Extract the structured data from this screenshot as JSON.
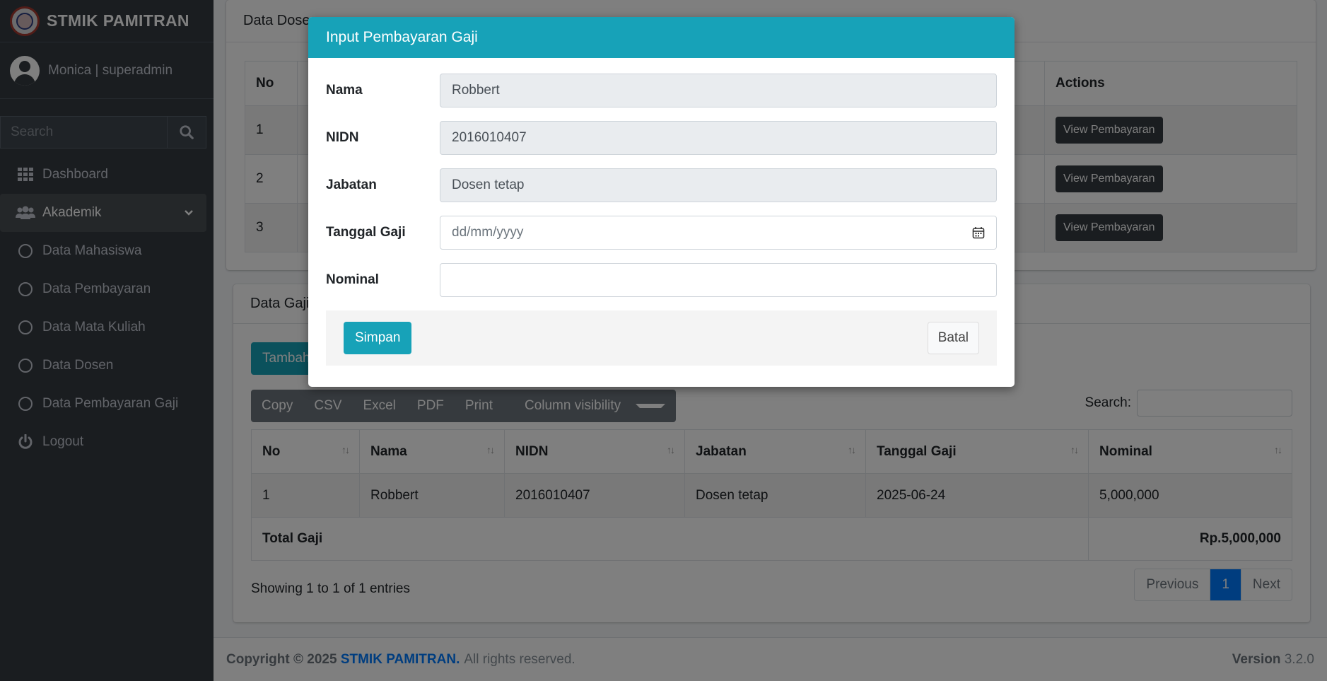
{
  "sidebar": {
    "brand": "STMIK PAMITRAN",
    "user": "Monica | superadmin",
    "search_placeholder": "Search",
    "items": [
      {
        "label": "Dashboard"
      },
      {
        "label": "Akademik"
      },
      {
        "label": "Data Mahasiswa"
      },
      {
        "label": "Data Pembayaran"
      },
      {
        "label": "Data Mata Kuliah"
      },
      {
        "label": "Data Dosen"
      },
      {
        "label": "Data Pembayaran Gaji"
      },
      {
        "label": "Logout"
      }
    ]
  },
  "dosen_card": {
    "title": "Data Dosen",
    "headers": {
      "no": "No",
      "actions": "Actions"
    },
    "rows": [
      {
        "no": "1",
        "action": "View Pembayaran"
      },
      {
        "no": "2",
        "action": "View Pembayaran"
      },
      {
        "no": "3",
        "action": "View Pembayaran"
      }
    ]
  },
  "gaji_card": {
    "title": "Data Gaji",
    "add_button": "Tambah",
    "buttons": [
      "Copy",
      "CSV",
      "Excel",
      "PDF",
      "Print",
      "Column visibility"
    ],
    "search_label": "Search:",
    "headers": [
      "No",
      "Nama",
      "NIDN",
      "Jabatan",
      "Tanggal Gaji",
      "Nominal"
    ],
    "rows": [
      {
        "no": "1",
        "nama": "Robbert",
        "nidn": "2016010407",
        "jabatan": "Dosen tetap",
        "tanggal": "2025-06-24",
        "nominal": "5,000,000"
      }
    ],
    "total_label": "Total Gaji",
    "total_value": "Rp.5,000,000",
    "info": "Showing 1 to 1 of 1 entries",
    "pager": {
      "prev": "Previous",
      "current": "1",
      "next": "Next"
    }
  },
  "footer": {
    "copyright_prefix": "Copyright © 2025 ",
    "brand": "STMIK PAMITRAN.",
    "suffix": " All rights reserved.",
    "version_label": "Version",
    "version": "3.2.0"
  },
  "modal": {
    "title": "Input Pembayaran Gaji",
    "fields": {
      "nama": {
        "label": "Nama",
        "value": "Robbert"
      },
      "nidn": {
        "label": "NIDN",
        "value": "2016010407"
      },
      "jabatan": {
        "label": "Jabatan",
        "value": "Dosen tetap"
      },
      "tanggal": {
        "label": "Tanggal Gaji",
        "placeholder": "dd/mm/yyyy"
      },
      "nominal": {
        "label": "Nominal",
        "value": ""
      }
    },
    "save": "Simpan",
    "cancel": "Batal"
  }
}
